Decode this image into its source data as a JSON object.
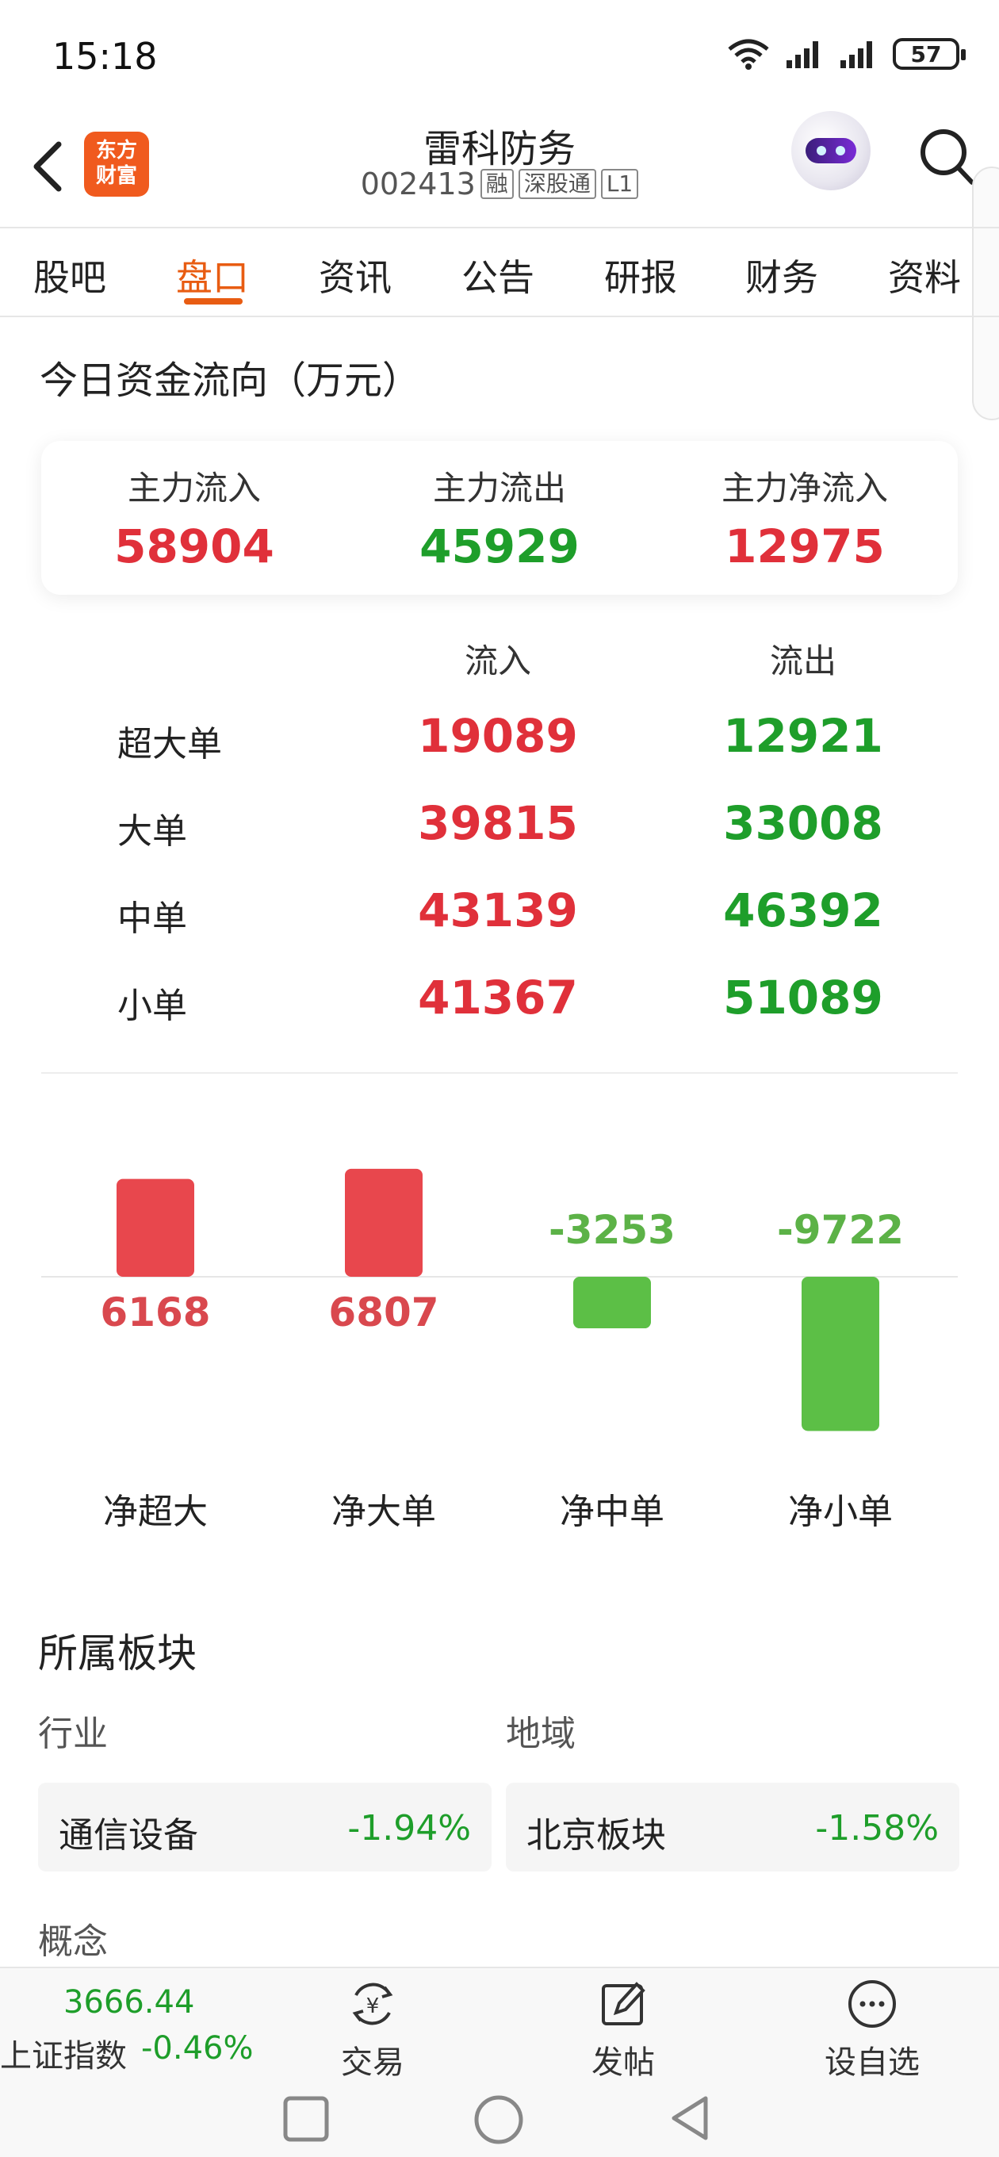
{
  "status_bar": {
    "time": "15:18",
    "battery": "57"
  },
  "header": {
    "logo_line1": "东方",
    "logo_line2": "财富",
    "stock_name": "雷科防务",
    "stock_code": "002413",
    "tags": [
      "融",
      "深股通",
      "L1"
    ]
  },
  "tabs": [
    {
      "label": "股吧"
    },
    {
      "label": "盘口"
    },
    {
      "label": "资讯"
    },
    {
      "label": "公告"
    },
    {
      "label": "研报"
    },
    {
      "label": "财务"
    },
    {
      "label": "资料"
    }
  ],
  "active_tab_index": 1,
  "fund_flow": {
    "title": "今日资金流向（万元）",
    "summary": [
      {
        "label": "主力流入",
        "value": "58904",
        "color": "#e0303a"
      },
      {
        "label": "主力流出",
        "value": "45929",
        "color": "#1e9e2a"
      },
      {
        "label": "主力净流入",
        "value": "12975",
        "color": "#e0303a"
      }
    ],
    "columns": [
      "流入",
      "流出"
    ],
    "rows": [
      {
        "label": "超大单",
        "in": "19089",
        "out": "12921"
      },
      {
        "label": "大单",
        "in": "39815",
        "out": "33008"
      },
      {
        "label": "中单",
        "in": "43139",
        "out": "46392"
      },
      {
        "label": "小单",
        "in": "41367",
        "out": "51089"
      }
    ]
  },
  "chart_data": {
    "type": "bar",
    "categories": [
      "净超大",
      "净大单",
      "净中单",
      "净小单"
    ],
    "values": [
      6168,
      6807,
      -3253,
      -9722
    ],
    "labels": [
      "6168",
      "6807",
      "-3253",
      "-9722"
    ],
    "positive_color": "#e8474d",
    "negative_color": "#5cbf46",
    "positive_label_color": "#d9484e",
    "negative_label_color": "#5cb247"
  },
  "sectors": {
    "title": "所属板块",
    "industry_label": "行业",
    "region_label": "地域",
    "industry": {
      "name": "通信设备",
      "change": "-1.94%"
    },
    "region": {
      "name": "北京板块",
      "change": "-1.58%"
    },
    "concept_label": "概念"
  },
  "bottom_bar": {
    "index_value": "3666.44",
    "index_name": "上证指数",
    "index_change": "-0.46%",
    "items": [
      {
        "label": "交易",
        "icon": "yuan-exchange-icon"
      },
      {
        "label": "发帖",
        "icon": "compose-icon"
      },
      {
        "label": "设自选",
        "icon": "more-circle-icon"
      }
    ]
  }
}
